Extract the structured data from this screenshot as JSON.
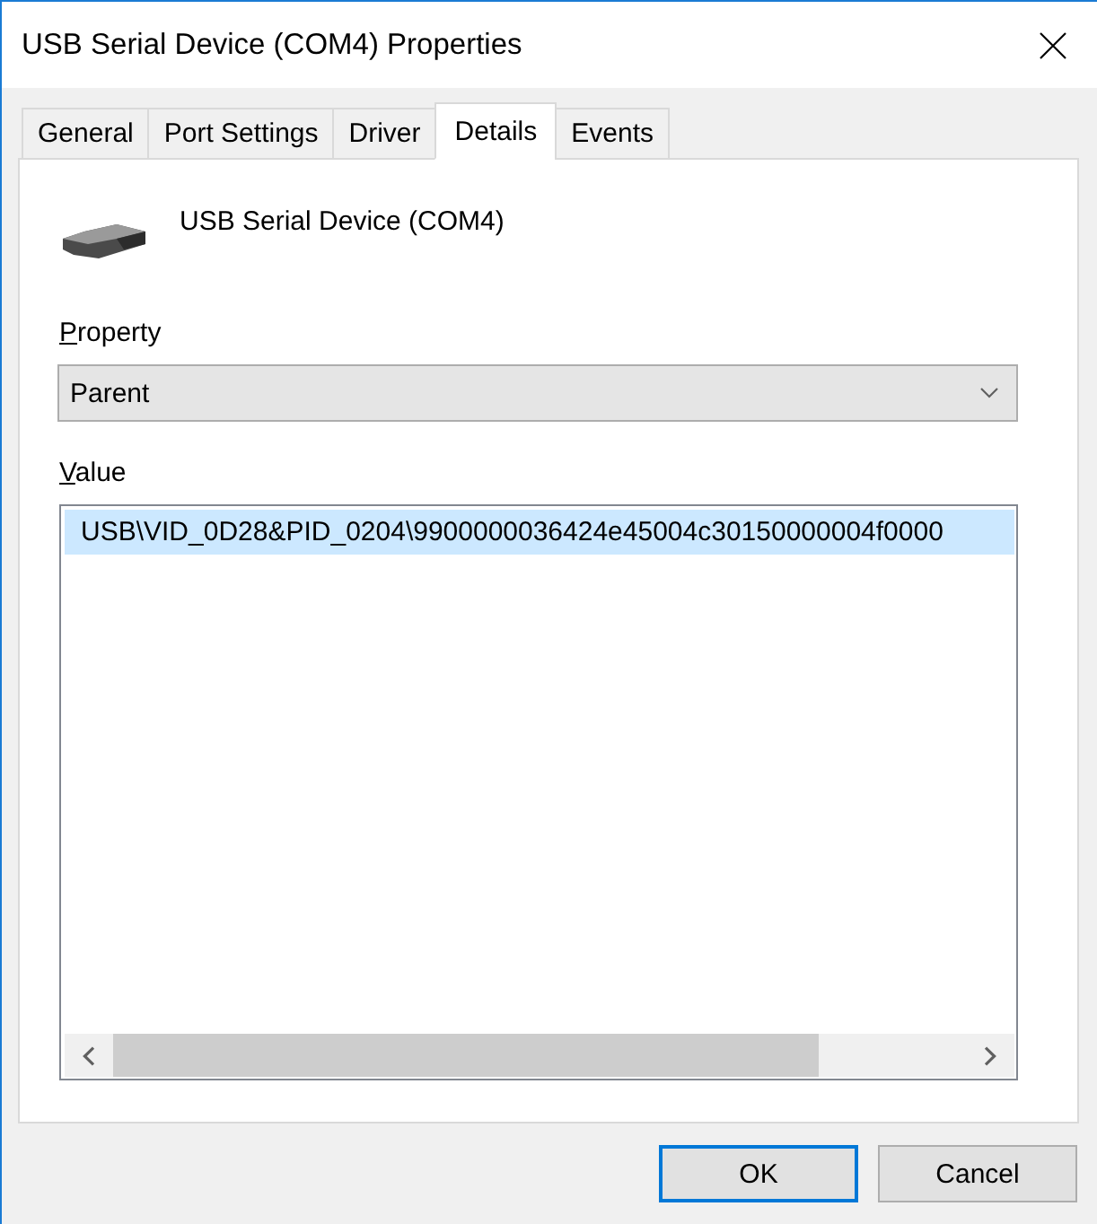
{
  "window": {
    "title": "USB Serial Device (COM4) Properties"
  },
  "tabs": [
    {
      "label": "General",
      "selected": false
    },
    {
      "label": "Port Settings",
      "selected": false
    },
    {
      "label": "Driver",
      "selected": false
    },
    {
      "label": "Details",
      "selected": true
    },
    {
      "label": "Events",
      "selected": false
    }
  ],
  "device": {
    "name": "USB Serial Device (COM4)"
  },
  "property": {
    "label": "Property",
    "value": "Parent"
  },
  "value": {
    "label": "Value",
    "items": [
      {
        "text": "USB\\VID_0D28&PID_0204\\9900000036424e45004c30150000004f0000",
        "selected": true
      }
    ]
  },
  "buttons": [
    {
      "label": "OK",
      "default": true
    },
    {
      "label": "Cancel",
      "default": false
    }
  ]
}
